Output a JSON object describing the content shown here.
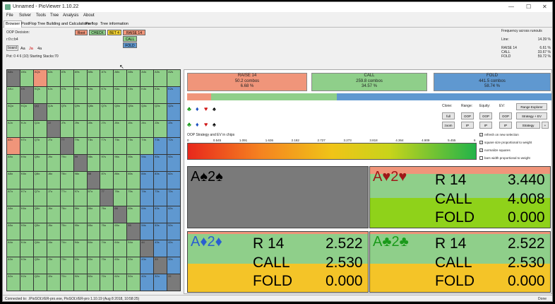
{
  "window": {
    "title": "Unnamed - PioViewer 1.10.22",
    "minimize": "—",
    "maximize": "☐",
    "close": "✕"
  },
  "menu": [
    "File",
    "Solver",
    "Tools",
    "Tree",
    "Analysis",
    "About"
  ],
  "tabs": [
    "Browser",
    "PostFlop Tree Building and Calculations",
    "Preflop",
    "Tree information"
  ],
  "left": {
    "decision": "OOP Decision:",
    "line": "r:0:c:b4",
    "board_label": "board",
    "cards": [
      "Aa",
      "Ja",
      "4a"
    ],
    "pot": "Pot: 0 4 6 (10) Starting Stacks:70"
  },
  "actions": {
    "root": "Root",
    "check": "CHECK",
    "bet": "BET 4",
    "raise": "RAISE 14",
    "call": "CALL",
    "fold": "FOLD"
  },
  "freq": {
    "title": "Frequency across runouts",
    "line_label": "Line:",
    "line_val": "14.39 %",
    "rows": [
      {
        "label": "RAISE 14",
        "val": "6.61 %"
      },
      {
        "label": "CALL",
        "val": "33.67 %"
      },
      {
        "label": "FOLD",
        "val": "59.72 %"
      }
    ]
  },
  "grid": {
    "labels": [
      [
        "AAs",
        "AKs",
        "AQs",
        "AJs",
        "ATs",
        "A9s",
        "A8s",
        "A7s",
        "A6s",
        "A5s",
        "A4s",
        "A3s",
        "A2s"
      ],
      [
        "AKo",
        "KK",
        "KQs",
        "KJs",
        "KTs",
        "K9s",
        "K8s",
        "K7s",
        "K6s",
        "K5s",
        "K4s",
        "K3s",
        "K2s"
      ],
      [
        "AQo",
        "KQo",
        "QQ",
        "QJs",
        "QTs",
        "Q9s",
        "Q8s",
        "Q7s",
        "Q6s",
        "Q5s",
        "Q4s",
        "Q3s",
        "Q2s"
      ],
      [
        "AJo",
        "KJo",
        "QJo",
        "JJ",
        "JTs",
        "J9s",
        "J8s",
        "J7s",
        "J6s",
        "J5s",
        "J4s",
        "J3s",
        "J2s"
      ],
      [
        "ATo",
        "KTo",
        "QTo",
        "JTo",
        "TT",
        "T9s",
        "T8s",
        "T7s",
        "T6s",
        "T5s",
        "T4s",
        "T3s",
        "T2s"
      ],
      [
        "A9o",
        "K9o",
        "Q9o",
        "J9o",
        "T9o",
        "99",
        "98s",
        "97s",
        "96s",
        "95s",
        "94s",
        "93s",
        "92s"
      ],
      [
        "A8o",
        "K8o",
        "Q8o",
        "J8o",
        "T8o",
        "98o",
        "88",
        "87s",
        "86s",
        "85s",
        "84s",
        "83s",
        "82s"
      ],
      [
        "A7o",
        "K7o",
        "Q7o",
        "J7o",
        "T7o",
        "97o",
        "87o",
        "77",
        "76s",
        "75s",
        "74s",
        "73s",
        "72s"
      ],
      [
        "A6o",
        "K6o",
        "Q6o",
        "J6o",
        "T6o",
        "96o",
        "86o",
        "76o",
        "66",
        "65s",
        "64s",
        "63s",
        "62s"
      ],
      [
        "A5o",
        "K5o",
        "Q5o",
        "J5o",
        "T5o",
        "95o",
        "85o",
        "75o",
        "65o",
        "55",
        "54s",
        "53s",
        "52s"
      ],
      [
        "A4o",
        "K4o",
        "Q4o",
        "J4o",
        "T4o",
        "94o",
        "84o",
        "74o",
        "64o",
        "54o",
        "44",
        "43s",
        "42s"
      ],
      [
        "A3o",
        "K3o",
        "Q3o",
        "J3o",
        "T3o",
        "93o",
        "83o",
        "73o",
        "63o",
        "53o",
        "43o",
        "33",
        "32s"
      ],
      [
        "A2o",
        "K2o",
        "Q2o",
        "J2o",
        "T2o",
        "92o",
        "82o",
        "72o",
        "62o",
        "52o",
        "42o",
        "32o",
        "22"
      ]
    ],
    "types": [
      "GGRGGGGGGGGGG",
      "GGGGGGGGGGGGB",
      "GGGGGGGGGGGGB",
      "GGGGGGGGGGGGB",
      "RGGGGGGGGGGBB",
      "GGGGGGGGGGBBB",
      "GGGGGGGGGGBBB",
      "GGGGGGGGGGBBB",
      "GGGGGGGGGGBBB",
      "GGGGGGGGGGBBB",
      "GGGGGGGGGGBBB",
      "GGGGGGGGGGBBB",
      "GGGGGGGGGGBBB"
    ]
  },
  "summary": [
    {
      "name": "RAISE 14",
      "combos": "50.2 combos",
      "pct": "6.68 %"
    },
    {
      "name": "CALL",
      "combos": "259.8 combos",
      "pct": "34.57 %"
    },
    {
      "name": "FOLD",
      "combos": "441.5 combos",
      "pct": "58.74 %"
    }
  ],
  "controls": {
    "clone": "Clone:",
    "range": "Range:",
    "equity": "Equity:",
    "ev": "EV:",
    "btns": [
      "full",
      "OOP",
      "OOP",
      "OOP",
      "zoom",
      "IP",
      "IP",
      "IP"
    ],
    "explorer": "Range Explorer",
    "strat_ev": "Strategy + EV",
    "strategy": "Strategy",
    "plus": "+"
  },
  "checks": [
    "refresh on new selection",
    "square size proportional to weight",
    "normalize squares",
    "bars width proportional to weight"
  ],
  "ev_title": "OOP Strategy and EV in chips",
  "ticks": [
    "0",
    "0.545",
    "1.091",
    "1.636",
    "2.182",
    "2.727",
    "3.273",
    "3.818",
    "4.364",
    "4.909",
    "5.455",
    "6"
  ],
  "hands": [
    {
      "cards": "A♠2♠",
      "rows": []
    },
    {
      "cards": "A♥2♥",
      "rows": [
        {
          "a": "R 14",
          "v": "3.440"
        },
        {
          "a": "CALL",
          "v": "4.008"
        },
        {
          "a": "FOLD",
          "v": "0.000"
        }
      ]
    },
    {
      "cards": "A♦2♦",
      "rows": [
        {
          "a": "R 14",
          "v": "2.522"
        },
        {
          "a": "CALL",
          "v": "2.530"
        },
        {
          "a": "FOLD",
          "v": "0.000"
        }
      ]
    },
    {
      "cards": "A♣2♣",
      "rows": [
        {
          "a": "R 14",
          "v": "2.522"
        },
        {
          "a": "CALL",
          "v": "2.530"
        },
        {
          "a": "FOLD",
          "v": "0.000"
        }
      ]
    }
  ],
  "colors": {
    "raise": "#f0957a",
    "call": "#8fcf8a",
    "fold": "#5f98d0",
    "gray": "#7a7a7a"
  },
  "status": {
    "left": "Connected to: .\\PioSOLVER-pro.exe, PioSOLVER-pro 1.10.19 (Aug 8 2018, 10:58:25)",
    "right": "Done"
  }
}
